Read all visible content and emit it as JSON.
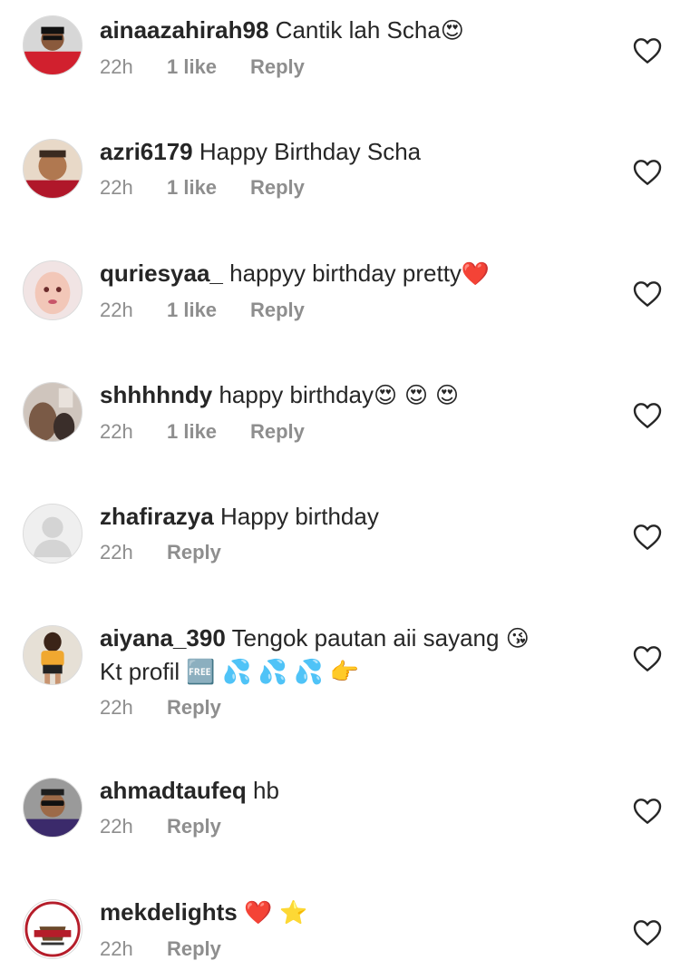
{
  "comments": [
    {
      "username": "ainaazahirah98",
      "text": "Cantik lah Scha",
      "emoji": "😍",
      "extra_line": "",
      "time": "22h",
      "likes": "1 like",
      "reply": "Reply",
      "avatar_icon": "profile-photo-icon"
    },
    {
      "username": "azri6179",
      "text": "Happy Birthday Scha",
      "emoji": "",
      "extra_line": "",
      "time": "22h",
      "likes": "1 like",
      "reply": "Reply",
      "avatar_icon": "profile-photo-icon"
    },
    {
      "username": "quriesyaa_",
      "text": "happyy  birthday pretty",
      "emoji": "❤️",
      "extra_line": "",
      "time": "22h",
      "likes": "1 like",
      "reply": "Reply",
      "avatar_icon": "profile-photo-icon"
    },
    {
      "username": "shhhhndy",
      "text": "happy birthday",
      "emoji": "😍 😍 😍",
      "extra_line": "",
      "time": "22h",
      "likes": "1 like",
      "reply": "Reply",
      "avatar_icon": "profile-photo-icon"
    },
    {
      "username": "zhafirazya",
      "text": "Happy birthday",
      "emoji": "",
      "extra_line": "",
      "time": "22h",
      "likes": "",
      "reply": "Reply",
      "avatar_icon": "default-avatar-icon"
    },
    {
      "username": "aiyana_390",
      "text": "Tengok pautan aii sayang",
      "emoji": "😘",
      "extra_line": "Kt profil 🆓 💦 💦 💦 👉",
      "time": "22h",
      "likes": "",
      "reply": "Reply",
      "avatar_icon": "profile-photo-icon"
    },
    {
      "username": "ahmadtaufeq",
      "text": "hb",
      "emoji": "",
      "extra_line": "",
      "time": "22h",
      "likes": "",
      "reply": "Reply",
      "avatar_icon": "profile-photo-icon"
    },
    {
      "username": "mekdelights",
      "text": "",
      "emoji": "❤️ ⭐",
      "extra_line": "",
      "time": "22h",
      "likes": "",
      "reply": "Reply",
      "avatar_icon": "logo-avatar-icon"
    }
  ],
  "icons": {
    "like": "heart-outline-icon"
  },
  "colors": {
    "text": "#262626",
    "meta": "#8e8e8e",
    "heart_stroke": "#262626"
  }
}
